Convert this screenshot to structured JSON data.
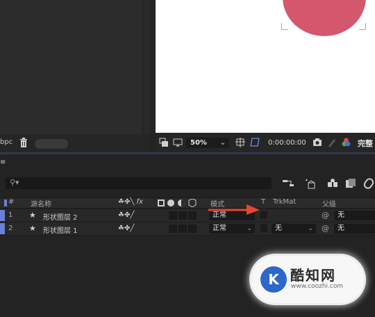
{
  "project": {
    "bit_depth": "bpc"
  },
  "viewer": {
    "zoom": "50%",
    "timecode": "0:00:00:00",
    "complete_label": "完整",
    "circle_color": "#d4586d"
  },
  "timeline": {
    "tab_glyph": "≡",
    "search_glyph": "⚲▾",
    "tools": [
      "comp-flowchart-icon",
      "shy-layers-icon",
      "frame-blending-icon",
      "motion-blur-icon",
      "graph-editor-icon"
    ],
    "columns": {
      "source_name": "源名称",
      "mode": "模式",
      "t": "T",
      "trkmat": "TrkMat",
      "parent": "父级"
    },
    "layers": [
      {
        "num": "1",
        "name": "形状图层 2",
        "mode": "正常",
        "trkmat": "",
        "parent": "无",
        "label_color": "#6a7fd6"
      },
      {
        "num": "2",
        "name": "形状图层 1",
        "mode": "正常",
        "trkmat": "无",
        "parent": "无",
        "label_color": "#6a7fd6"
      }
    ]
  },
  "watermark": {
    "logo": "K",
    "name": "酷知网",
    "url": "www.coozhi.com"
  },
  "accent": "#e8452f"
}
